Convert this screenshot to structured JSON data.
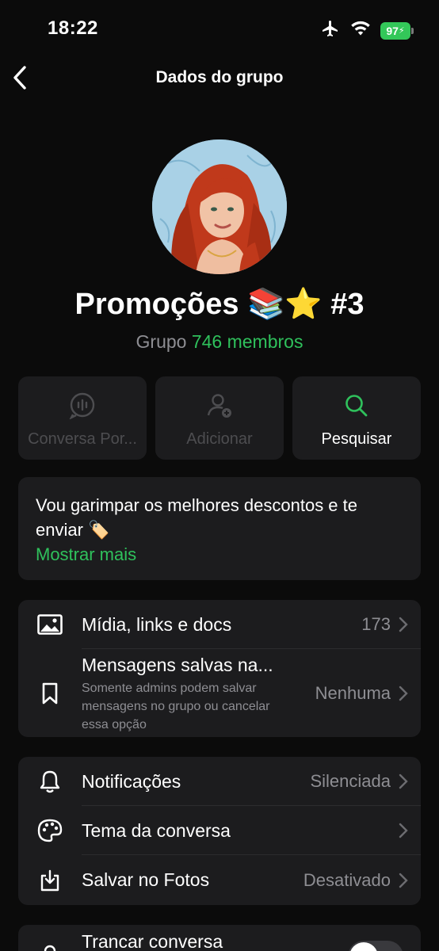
{
  "status_bar": {
    "time": "18:22",
    "battery": "97"
  },
  "nav": {
    "title": "Dados do grupo"
  },
  "group": {
    "name": "Promoções 📚⭐ #3",
    "type_label": "Grupo",
    "members": "746 membros"
  },
  "actions": [
    {
      "label": "Conversa Por...",
      "icon": "voice-chat-icon",
      "enabled": false
    },
    {
      "label": "Adicionar",
      "icon": "add-person-icon",
      "enabled": false
    },
    {
      "label": "Pesquisar",
      "icon": "search-icon",
      "enabled": true
    }
  ],
  "description": {
    "text": "Vou garimpar os melhores descontos e te enviar 🏷️",
    "show_more": "Mostrar mais"
  },
  "group_one": {
    "media": {
      "label": "Mídia, links e docs",
      "value": "173"
    },
    "saved": {
      "label": "Mensagens salvas na...",
      "sub": "Somente admins podem salvar mensagens no grupo ou cancelar essa opção",
      "value": "Nenhuma"
    }
  },
  "group_two": {
    "notifications": {
      "label": "Notificações",
      "value": "Silenciada"
    },
    "theme": {
      "label": "Tema da conversa"
    },
    "save_photos": {
      "label": "Salvar no Fotos",
      "value": "Desativado"
    }
  },
  "group_three": {
    "lock": {
      "label": "Trancar conversa"
    }
  },
  "colors": {
    "accent": "#2fc15c",
    "background": "#0b0b0b",
    "card": "#1c1c1e"
  }
}
